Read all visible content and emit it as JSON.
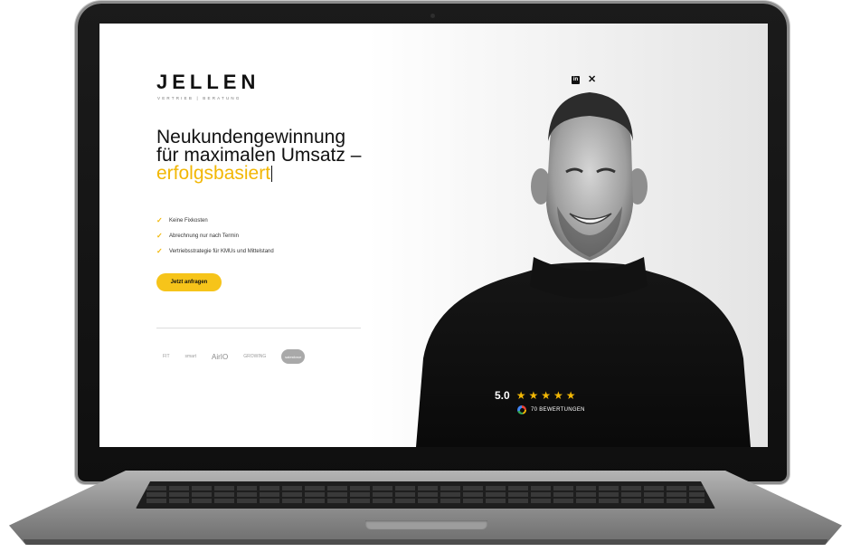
{
  "header": {
    "logo": "JELLEN",
    "tagline": "VERTRIEB | BERATUNG",
    "social": {
      "linkedin_icon": "linkedin-icon",
      "xing_icon": "xing-icon"
    }
  },
  "hero": {
    "headline_line1": "Neukundengewinnung",
    "headline_line2": "für maximalen Umsatz –",
    "headline_accent": "erfolgsbasiert",
    "benefits": [
      "Keine Fixkosten",
      "Abrechnung nur nach Termin",
      "Vertriebsstrategie für KMUs und Mittelstand"
    ],
    "cta_label": "Jetzt anfragen"
  },
  "partners": [
    "FIT",
    "smart",
    "AirIO",
    "GROWING",
    "salesforce"
  ],
  "rating": {
    "score": "5.0",
    "stars": 5,
    "reviews_label": "70 BEWERTUNGEN"
  },
  "colors": {
    "accent": "#f2b705",
    "text": "#111111",
    "background": "#ffffff"
  }
}
